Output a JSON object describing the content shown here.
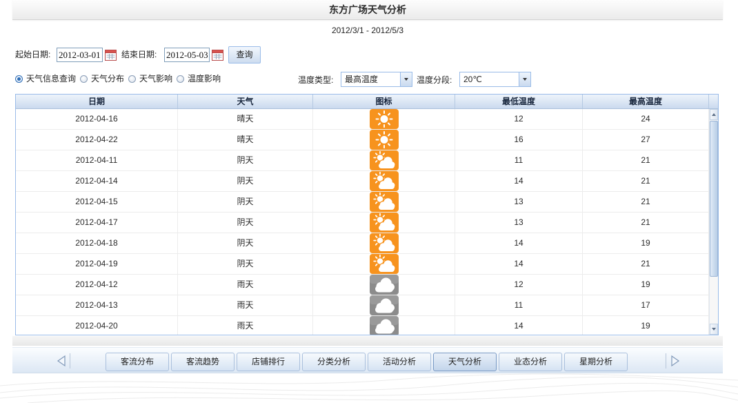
{
  "title": "东方广场天气分析",
  "date_range": "2012/3/1 - 2012/5/3",
  "filters": {
    "start_label": "起始日期:",
    "start_value": "2012-03-01",
    "end_label": "结束日期:",
    "end_value": "2012-05-03",
    "query_button": "查询"
  },
  "modes": [
    {
      "label": "天气信息查询",
      "checked": true
    },
    {
      "label": "天气分布",
      "checked": false
    },
    {
      "label": "天气影响",
      "checked": false
    },
    {
      "label": "温度影响",
      "checked": false
    }
  ],
  "temperature_type": {
    "label": "温度类型:",
    "selected": "最高温度"
  },
  "temperature_step": {
    "label": "温度分段:",
    "selected": "20℃"
  },
  "table": {
    "columns": [
      "日期",
      "天气",
      "图标",
      "最低温度",
      "最高温度"
    ],
    "rows": [
      {
        "date": "2012-04-16",
        "weather": "晴天",
        "icon": "sunny-icon",
        "low": 12,
        "high": 24
      },
      {
        "date": "2012-04-22",
        "weather": "晴天",
        "icon": "sunny-icon",
        "low": 16,
        "high": 27
      },
      {
        "date": "2012-04-11",
        "weather": "阴天",
        "icon": "partly-cloudy-icon",
        "low": 11,
        "high": 21
      },
      {
        "date": "2012-04-14",
        "weather": "阴天",
        "icon": "partly-cloudy-icon",
        "low": 14,
        "high": 21
      },
      {
        "date": "2012-04-15",
        "weather": "阴天",
        "icon": "partly-cloudy-icon",
        "low": 13,
        "high": 21
      },
      {
        "date": "2012-04-17",
        "weather": "阴天",
        "icon": "partly-cloudy-icon",
        "low": 13,
        "high": 21
      },
      {
        "date": "2012-04-18",
        "weather": "阴天",
        "icon": "partly-cloudy-icon",
        "low": 14,
        "high": 19
      },
      {
        "date": "2012-04-19",
        "weather": "阴天",
        "icon": "partly-cloudy-icon",
        "low": 14,
        "high": 21
      },
      {
        "date": "2012-04-12",
        "weather": "雨天",
        "icon": "cloud-icon",
        "low": 12,
        "high": 19
      },
      {
        "date": "2012-04-13",
        "weather": "雨天",
        "icon": "cloud-icon",
        "low": 11,
        "high": 17
      },
      {
        "date": "2012-04-20",
        "weather": "雨天",
        "icon": "cloud-icon",
        "low": 14,
        "high": 19
      }
    ]
  },
  "icons": {
    "date_picker": "calendar-icon",
    "combo_trigger": "dropdown-arrow-icon",
    "nav_prev": "triangle-left-icon",
    "nav_next": "triangle-right-icon",
    "scroll_up": "scroll-up-icon",
    "scroll_down": "scroll-down-icon"
  },
  "nav": {
    "tabs": [
      {
        "label": "客流分布",
        "active": false
      },
      {
        "label": "客流趋势",
        "active": false
      },
      {
        "label": "店铺排行",
        "active": false
      },
      {
        "label": "分类分析",
        "active": false
      },
      {
        "label": "活动分析",
        "active": false
      },
      {
        "label": "天气分析",
        "active": true
      },
      {
        "label": "业态分析",
        "active": false
      },
      {
        "label": "星期分析",
        "active": false
      }
    ]
  },
  "colors": {
    "sunny_icon_bg": "#f7931e",
    "cloud_icon_bg": "#8c8c8c",
    "header_bg": "#cbdaee",
    "grid_border": "#99bbe8",
    "radio_checked": "#2d6cb5"
  }
}
